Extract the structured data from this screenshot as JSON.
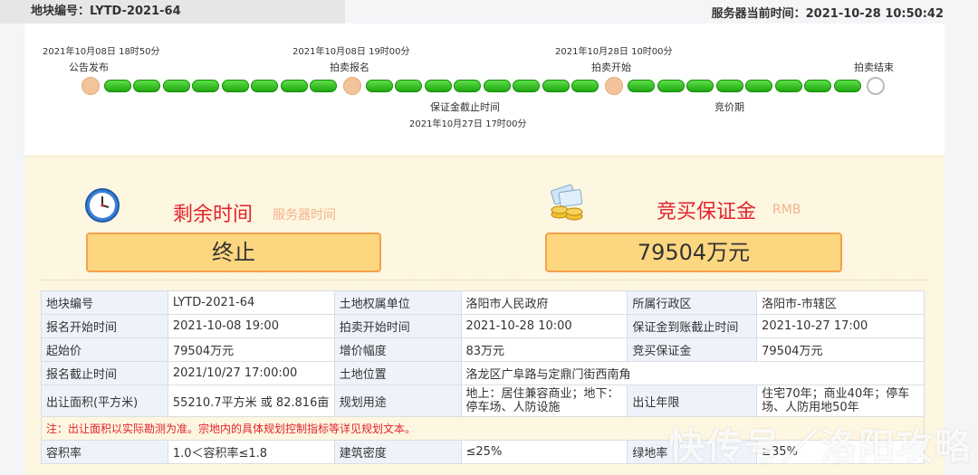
{
  "header": {
    "lot_tag": "地块编号：LYTD-2021-64",
    "server_time": "服务器当前时间：2021-10-28 10:50:42"
  },
  "timeline": {
    "stages": [
      {
        "date": "2021年10月08日 18时50分",
        "label": "公告发布"
      },
      {
        "date": "2021年10月08日 19时00分",
        "label": "拍卖报名"
      },
      {
        "date": "2021年10月28日 10时00分",
        "label": "拍卖开始"
      },
      {
        "label": "拍卖结束"
      }
    ],
    "below": [
      {
        "label": "保证金截止时间",
        "date": "2021年10月27日 17时00分"
      },
      {
        "label": "竞价期"
      }
    ]
  },
  "summary": {
    "remaining_title": "剩余时间",
    "remaining_sub": "服务器时间",
    "remaining_value": "终止",
    "deposit_title": "竞买保证金",
    "deposit_sub": "RMB",
    "deposit_value": "79504万元"
  },
  "details": {
    "rows": [
      [
        "地块编号",
        "LYTD-2021-64",
        "土地权属单位",
        "洛阳市人民政府",
        "所属行政区",
        "洛阳市-市辖区"
      ],
      [
        "报名开始时间",
        "2021-10-08 19:00",
        "拍卖开始时间",
        "2021-10-28 10:00",
        "保证金到账截止时间",
        "2021-10-27 17:00"
      ],
      [
        "起始价",
        "79504万元",
        "增价幅度",
        "83万元",
        "竞买保证金",
        "79504万元"
      ]
    ],
    "row4": [
      "报名截止时间",
      "2021/10/27 17:00:00",
      "土地位置",
      "洛龙区广阜路与定鼎门街西南角"
    ],
    "row5": [
      "出让面积(平方米)",
      "55210.7平方米 或  82.816亩",
      "规划用途",
      "地上：居住兼容商业；地下：停车场、人防设施",
      "出让年限",
      "住宅70年；商业40年；停车场、人防用地50年"
    ],
    "note": "注：出让面积以实际勘测为准。宗地内的具体规划控制指标等详见规划文本。",
    "row6": [
      "容积率",
      "1.0＜容积率≤1.8",
      "建筑密度",
      "≤25%",
      "绿地率",
      "≥35%"
    ]
  },
  "watermark": "快传号／洛阳攻略",
  "colors": {
    "accent_red": "#e3232b",
    "progress_green": "#1fa70f",
    "value_box": "#fcd77f"
  }
}
